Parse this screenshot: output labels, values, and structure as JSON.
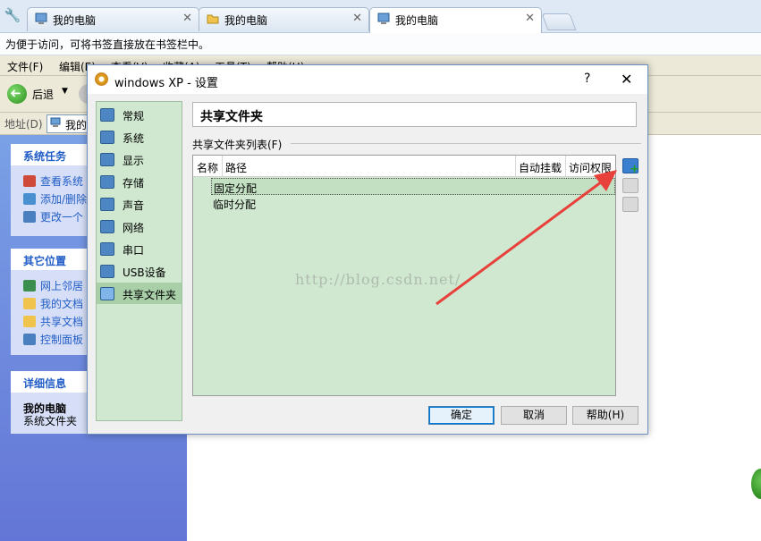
{
  "browser": {
    "tabs": [
      {
        "label": "我的电脑",
        "icon": "computer-icon",
        "active": false
      },
      {
        "label": "我的电脑",
        "icon": "folder-icon",
        "active": false
      },
      {
        "label": "我的电脑",
        "icon": "computer-icon",
        "active": true
      }
    ],
    "close_glyph": "✕",
    "bookmark_hint": "为便于访问，可将书签直接放在书签栏中。"
  },
  "xp_window": {
    "menus": [
      "文件(F)",
      "编辑(E)",
      "查看(V)",
      "收藏(A)",
      "工具(T)",
      "帮助(H)"
    ],
    "back_label": "后退",
    "address_label": "地址(D)",
    "address_value": "我的",
    "panels": [
      {
        "title": "系统任务",
        "links": [
          "查看系统",
          "添加/删除",
          "更改一个"
        ]
      },
      {
        "title": "其它位置",
        "links": [
          "网上邻居",
          "我的文档",
          "共享文档",
          "控制面板"
        ]
      },
      {
        "title": "详细信息",
        "detail_title": "我的电脑",
        "detail_sub": "系统文件夹"
      }
    ]
  },
  "dialog": {
    "title": "windows XP - 设置",
    "help_glyph": "?",
    "close_glyph": "✕",
    "nav_items": [
      {
        "label": "常规",
        "icon": "general-icon"
      },
      {
        "label": "系统",
        "icon": "system-icon"
      },
      {
        "label": "显示",
        "icon": "display-icon"
      },
      {
        "label": "存储",
        "icon": "storage-icon"
      },
      {
        "label": "声音",
        "icon": "audio-icon"
      },
      {
        "label": "网络",
        "icon": "network-icon"
      },
      {
        "label": "串口",
        "icon": "serial-port-icon"
      },
      {
        "label": "USB设备",
        "icon": "usb-icon"
      },
      {
        "label": "共享文件夹",
        "icon": "shared-folder-icon",
        "selected": true
      }
    ],
    "page_title": "共享文件夹",
    "list_label": "共享文件夹列表(F)",
    "columns": [
      "名称",
      "路径",
      "自动挂载",
      "访问权限"
    ],
    "rows": [
      "固定分配",
      "临时分配"
    ],
    "buttons": {
      "ok": "确定",
      "cancel": "取消",
      "help": "帮助(H)"
    }
  },
  "watermark": "http://blog.csdn.net/",
  "colors": {
    "annotation_arrow": "#e8413c",
    "selection_green": "#cfe8cf"
  }
}
